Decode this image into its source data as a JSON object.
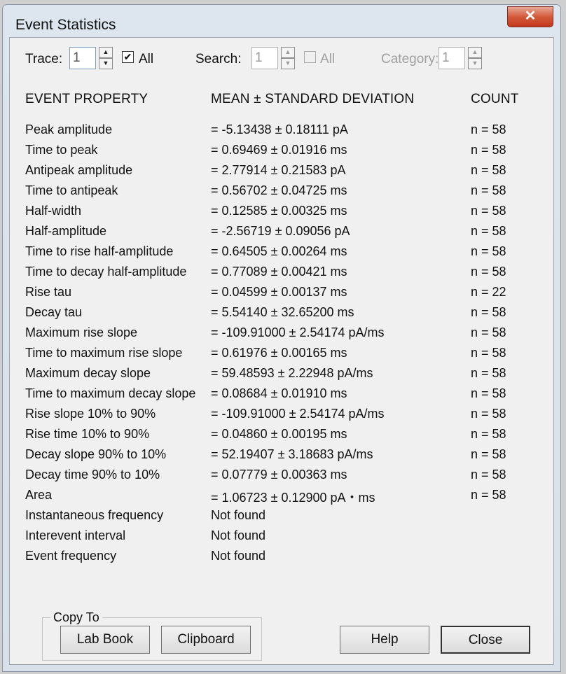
{
  "window": {
    "title": "Event Statistics",
    "close_glyph": "✕"
  },
  "toolbar": {
    "trace_label": "Trace:",
    "trace_value": "1",
    "trace_all_label": "All",
    "search_label": "Search:",
    "search_value": "1",
    "search_all_label": "All",
    "category_label": "Category:",
    "category_value": "1"
  },
  "table": {
    "headers": [
      "EVENT PROPERTY",
      "MEAN ± STANDARD DEVIATION",
      "COUNT"
    ],
    "rows": [
      {
        "property": "Peak amplitude",
        "value": "= -5.13438 ± 0.18111 pA",
        "count": "n = 58"
      },
      {
        "property": "Time to peak",
        "value": "= 0.69469 ± 0.01916 ms",
        "count": "n = 58"
      },
      {
        "property": "Antipeak amplitude",
        "value": "= 2.77914 ± 0.21583 pA",
        "count": "n = 58"
      },
      {
        "property": "Time to antipeak",
        "value": "= 0.56702 ± 0.04725 ms",
        "count": "n = 58"
      },
      {
        "property": "Half-width",
        "value": "= 0.12585 ± 0.00325 ms",
        "count": "n = 58"
      },
      {
        "property": "Half-amplitude",
        "value": "= -2.56719 ± 0.09056 pA",
        "count": "n = 58"
      },
      {
        "property": "Time to rise half-amplitude",
        "value": "= 0.64505 ± 0.00264 ms",
        "count": "n = 58"
      },
      {
        "property": "Time to decay half-amplitude",
        "value": "= 0.77089 ± 0.00421 ms",
        "count": "n = 58"
      },
      {
        "property": "Rise tau",
        "value": "= 0.04599 ± 0.00137 ms",
        "count": "n = 22"
      },
      {
        "property": "Decay tau",
        "value": "= 5.54140 ± 32.65200 ms",
        "count": "n = 58"
      },
      {
        "property": "Maximum rise slope",
        "value": "= -109.91000 ± 2.54174 pA/ms",
        "count": "n = 58"
      },
      {
        "property": "Time to maximum rise slope",
        "value": "= 0.61976 ± 0.00165 ms",
        "count": "n = 58"
      },
      {
        "property": "Maximum decay slope",
        "value": "= 59.48593 ± 2.22948 pA/ms",
        "count": "n = 58"
      },
      {
        "property": "Time to maximum decay slope",
        "value": "= 0.08684 ± 0.01910 ms",
        "count": "n = 58"
      },
      {
        "property": "Rise slope 10% to 90%",
        "value": "= -109.91000 ± 2.54174 pA/ms",
        "count": "n = 58"
      },
      {
        "property": "Rise time 10% to 90%",
        "value": "= 0.04860 ± 0.00195 ms",
        "count": "n = 58"
      },
      {
        "property": "Decay slope 90% to 10%",
        "value": "= 52.19407 ± 3.18683 pA/ms",
        "count": "n = 58"
      },
      {
        "property": "Decay time 90% to 10%",
        "value": "= 0.07779 ± 0.00363 ms",
        "count": "n = 58"
      },
      {
        "property": "Area",
        "value": "= 1.06723 ± 0.12900 pA・ms",
        "count": "n = 58"
      },
      {
        "property": "Instantaneous frequency",
        "value": "Not found",
        "count": ""
      },
      {
        "property": "Interevent interval",
        "value": "Not found",
        "count": ""
      },
      {
        "property": "Event frequency",
        "value": "Not found",
        "count": ""
      }
    ]
  },
  "copy_group": {
    "label": "Copy To",
    "lab_book": "Lab Book",
    "clipboard": "Clipboard"
  },
  "buttons": {
    "help": "Help",
    "close": "Close"
  }
}
